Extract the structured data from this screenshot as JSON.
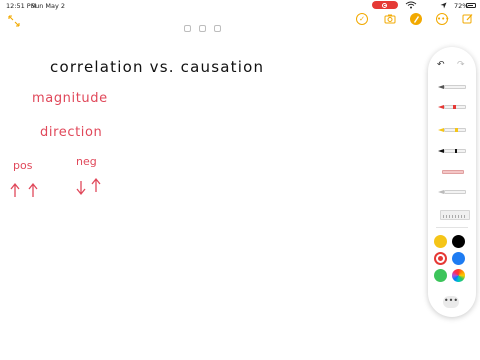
{
  "status_bar": {
    "time": "12:51 PM",
    "date": "Sun May 2",
    "wifi_icon": "wifi-icon",
    "battery_percent": "72%"
  },
  "toolbar": {
    "collapse_icon": "collapse-arrows-icon",
    "checklist_icon": "checklist-icon",
    "camera_icon": "camera-icon",
    "markup_icon": "markup-pen-icon",
    "more_icon": "ellipsis-icon",
    "compose_icon": "compose-icon",
    "accent_color": "#f2a900"
  },
  "note": {
    "title": "correlation  vs.  causation",
    "lines": [
      "magnitude",
      "direction"
    ],
    "labels": [
      "pos",
      "neg"
    ],
    "arrows": {
      "pos": [
        "up-arrow",
        "up-arrow"
      ],
      "neg": [
        "down-arrow",
        "up-arrow"
      ]
    },
    "ink_colors": {
      "title": "#111111",
      "notes": "#e0485a"
    }
  },
  "palette": {
    "tools": [
      "pen",
      "marker",
      "highlighter",
      "pencil",
      "eraser",
      "lasso",
      "ruler"
    ],
    "colors": [
      "#f5c518",
      "#000000",
      "#e53935",
      "#1e7cf2",
      "#3cc45a",
      "color-wheel"
    ],
    "selected_color": "#e53935",
    "more_label": "•••"
  }
}
